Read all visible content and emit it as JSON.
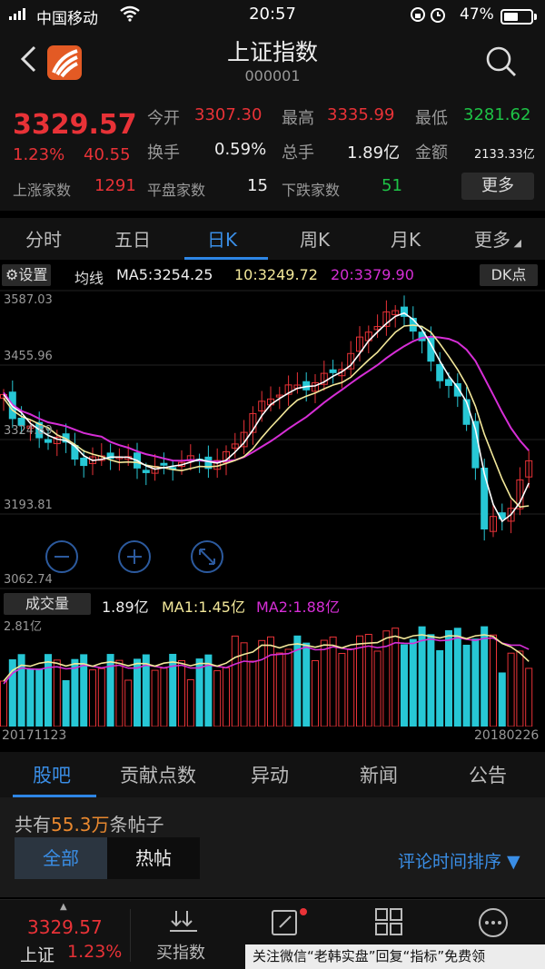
{
  "status_bar": {
    "carrier": "中国移动",
    "time": "20:57",
    "battery": "47%"
  },
  "header": {
    "title": "上证指数",
    "code": "000001"
  },
  "quote": {
    "price": "3329.57",
    "pct": "1.23%",
    "change": "40.55",
    "open_label": "今开",
    "open": "3307.30",
    "high_label": "最高",
    "high": "3335.99",
    "low_label": "最低",
    "low": "3281.62",
    "turnover_label": "换手",
    "turnover": "0.59%",
    "volume_label": "总手",
    "volume": "1.89亿",
    "amount_label": "金额",
    "amount": "2133.33亿",
    "up_label": "上涨家数",
    "up": "1291",
    "flat_label": "平盘家数",
    "flat": "15",
    "down_label": "下跌家数",
    "down": "51",
    "more": "更多"
  },
  "period_tabs": [
    "分时",
    "五日",
    "日K",
    "周K",
    "月K",
    "更多"
  ],
  "ma_bar": {
    "settings": "设置",
    "label": "均线",
    "ma5": "MA5:3254.25",
    "ma10": "10:3249.72",
    "ma20": "20:3379.90",
    "dk": "DK点"
  },
  "kline_axis": {
    "top": "3587.03",
    "mid": "3455.96",
    "low_mid": "3324.89",
    "lower": "3193.81",
    "bottom": "3062.74"
  },
  "volume_bar": {
    "label": "成交量",
    "value": "1.89亿",
    "ma1": "MA1:1.45亿",
    "ma2": "MA2:1.88亿",
    "axis_top": "2.81亿"
  },
  "dates": {
    "start": "20171123",
    "end": "20180226"
  },
  "news_tabs": [
    "股吧",
    "贡献点数",
    "异动",
    "新闻",
    "公告"
  ],
  "posts": {
    "prefix": "共有",
    "count": "55.3万",
    "suffix": "条帖子",
    "filter_all": "全部",
    "filter_hot": "热帖",
    "sort": "评论时间排序"
  },
  "bottom_nav": {
    "price": "3329.57",
    "name": "上证",
    "pct": "1.23%",
    "buy": "买指数"
  },
  "watermark": "关注微信“老韩实盘”回复“指标”免费领",
  "colors": {
    "up": "#e83237",
    "down": "#27c7d5",
    "ma5": "#ffffff",
    "ma10": "#f3e89a",
    "ma20": "#d62ed6",
    "accent": "#2e86e6"
  }
}
